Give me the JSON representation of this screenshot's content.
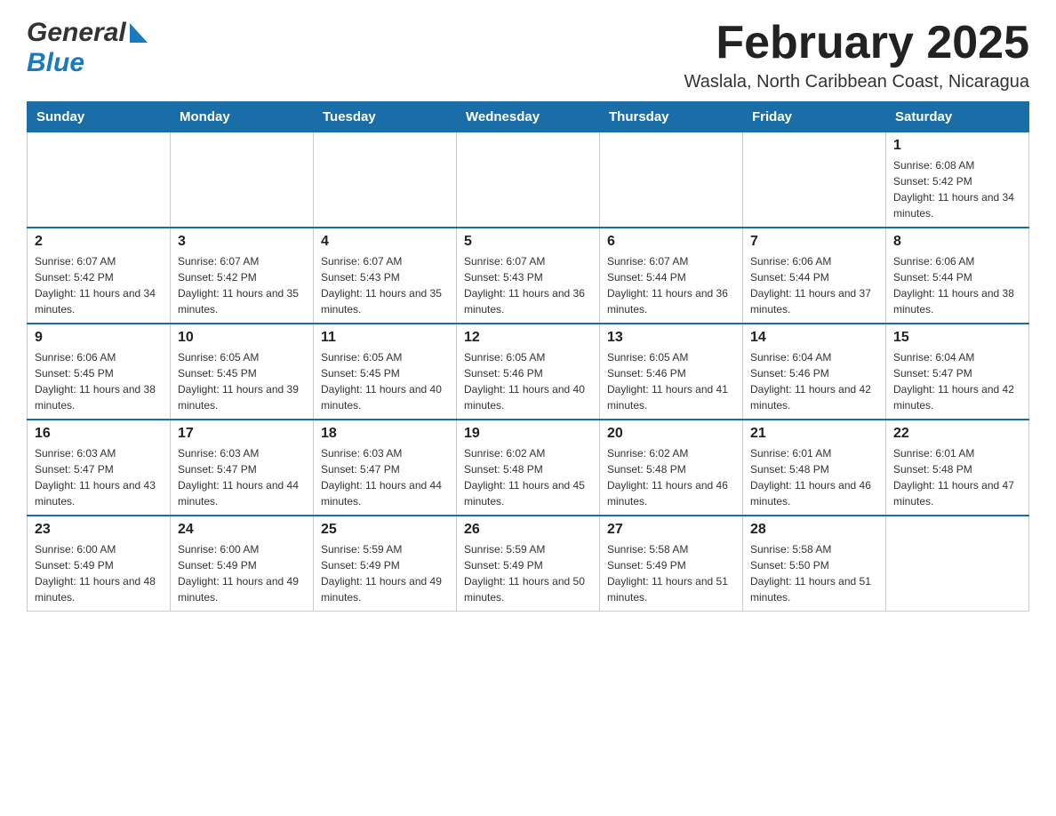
{
  "logo": {
    "line1": "General",
    "arrow_color": "#1a7abf",
    "line2": "Blue"
  },
  "header": {
    "month_year": "February 2025",
    "location": "Waslala, North Caribbean Coast, Nicaragua"
  },
  "days_of_week": [
    "Sunday",
    "Monday",
    "Tuesday",
    "Wednesday",
    "Thursday",
    "Friday",
    "Saturday"
  ],
  "weeks": [
    [
      {
        "day": "",
        "sunrise": "",
        "sunset": "",
        "daylight": "",
        "empty": true
      },
      {
        "day": "",
        "sunrise": "",
        "sunset": "",
        "daylight": "",
        "empty": true
      },
      {
        "day": "",
        "sunrise": "",
        "sunset": "",
        "daylight": "",
        "empty": true
      },
      {
        "day": "",
        "sunrise": "",
        "sunset": "",
        "daylight": "",
        "empty": true
      },
      {
        "day": "",
        "sunrise": "",
        "sunset": "",
        "daylight": "",
        "empty": true
      },
      {
        "day": "",
        "sunrise": "",
        "sunset": "",
        "daylight": "",
        "empty": true
      },
      {
        "day": "1",
        "sunrise": "Sunrise: 6:08 AM",
        "sunset": "Sunset: 5:42 PM",
        "daylight": "Daylight: 11 hours and 34 minutes.",
        "empty": false
      }
    ],
    [
      {
        "day": "2",
        "sunrise": "Sunrise: 6:07 AM",
        "sunset": "Sunset: 5:42 PM",
        "daylight": "Daylight: 11 hours and 34 minutes.",
        "empty": false
      },
      {
        "day": "3",
        "sunrise": "Sunrise: 6:07 AM",
        "sunset": "Sunset: 5:42 PM",
        "daylight": "Daylight: 11 hours and 35 minutes.",
        "empty": false
      },
      {
        "day": "4",
        "sunrise": "Sunrise: 6:07 AM",
        "sunset": "Sunset: 5:43 PM",
        "daylight": "Daylight: 11 hours and 35 minutes.",
        "empty": false
      },
      {
        "day": "5",
        "sunrise": "Sunrise: 6:07 AM",
        "sunset": "Sunset: 5:43 PM",
        "daylight": "Daylight: 11 hours and 36 minutes.",
        "empty": false
      },
      {
        "day": "6",
        "sunrise": "Sunrise: 6:07 AM",
        "sunset": "Sunset: 5:44 PM",
        "daylight": "Daylight: 11 hours and 36 minutes.",
        "empty": false
      },
      {
        "day": "7",
        "sunrise": "Sunrise: 6:06 AM",
        "sunset": "Sunset: 5:44 PM",
        "daylight": "Daylight: 11 hours and 37 minutes.",
        "empty": false
      },
      {
        "day": "8",
        "sunrise": "Sunrise: 6:06 AM",
        "sunset": "Sunset: 5:44 PM",
        "daylight": "Daylight: 11 hours and 38 minutes.",
        "empty": false
      }
    ],
    [
      {
        "day": "9",
        "sunrise": "Sunrise: 6:06 AM",
        "sunset": "Sunset: 5:45 PM",
        "daylight": "Daylight: 11 hours and 38 minutes.",
        "empty": false
      },
      {
        "day": "10",
        "sunrise": "Sunrise: 6:05 AM",
        "sunset": "Sunset: 5:45 PM",
        "daylight": "Daylight: 11 hours and 39 minutes.",
        "empty": false
      },
      {
        "day": "11",
        "sunrise": "Sunrise: 6:05 AM",
        "sunset": "Sunset: 5:45 PM",
        "daylight": "Daylight: 11 hours and 40 minutes.",
        "empty": false
      },
      {
        "day": "12",
        "sunrise": "Sunrise: 6:05 AM",
        "sunset": "Sunset: 5:46 PM",
        "daylight": "Daylight: 11 hours and 40 minutes.",
        "empty": false
      },
      {
        "day": "13",
        "sunrise": "Sunrise: 6:05 AM",
        "sunset": "Sunset: 5:46 PM",
        "daylight": "Daylight: 11 hours and 41 minutes.",
        "empty": false
      },
      {
        "day": "14",
        "sunrise": "Sunrise: 6:04 AM",
        "sunset": "Sunset: 5:46 PM",
        "daylight": "Daylight: 11 hours and 42 minutes.",
        "empty": false
      },
      {
        "day": "15",
        "sunrise": "Sunrise: 6:04 AM",
        "sunset": "Sunset: 5:47 PM",
        "daylight": "Daylight: 11 hours and 42 minutes.",
        "empty": false
      }
    ],
    [
      {
        "day": "16",
        "sunrise": "Sunrise: 6:03 AM",
        "sunset": "Sunset: 5:47 PM",
        "daylight": "Daylight: 11 hours and 43 minutes.",
        "empty": false
      },
      {
        "day": "17",
        "sunrise": "Sunrise: 6:03 AM",
        "sunset": "Sunset: 5:47 PM",
        "daylight": "Daylight: 11 hours and 44 minutes.",
        "empty": false
      },
      {
        "day": "18",
        "sunrise": "Sunrise: 6:03 AM",
        "sunset": "Sunset: 5:47 PM",
        "daylight": "Daylight: 11 hours and 44 minutes.",
        "empty": false
      },
      {
        "day": "19",
        "sunrise": "Sunrise: 6:02 AM",
        "sunset": "Sunset: 5:48 PM",
        "daylight": "Daylight: 11 hours and 45 minutes.",
        "empty": false
      },
      {
        "day": "20",
        "sunrise": "Sunrise: 6:02 AM",
        "sunset": "Sunset: 5:48 PM",
        "daylight": "Daylight: 11 hours and 46 minutes.",
        "empty": false
      },
      {
        "day": "21",
        "sunrise": "Sunrise: 6:01 AM",
        "sunset": "Sunset: 5:48 PM",
        "daylight": "Daylight: 11 hours and 46 minutes.",
        "empty": false
      },
      {
        "day": "22",
        "sunrise": "Sunrise: 6:01 AM",
        "sunset": "Sunset: 5:48 PM",
        "daylight": "Daylight: 11 hours and 47 minutes.",
        "empty": false
      }
    ],
    [
      {
        "day": "23",
        "sunrise": "Sunrise: 6:00 AM",
        "sunset": "Sunset: 5:49 PM",
        "daylight": "Daylight: 11 hours and 48 minutes.",
        "empty": false
      },
      {
        "day": "24",
        "sunrise": "Sunrise: 6:00 AM",
        "sunset": "Sunset: 5:49 PM",
        "daylight": "Daylight: 11 hours and 49 minutes.",
        "empty": false
      },
      {
        "day": "25",
        "sunrise": "Sunrise: 5:59 AM",
        "sunset": "Sunset: 5:49 PM",
        "daylight": "Daylight: 11 hours and 49 minutes.",
        "empty": false
      },
      {
        "day": "26",
        "sunrise": "Sunrise: 5:59 AM",
        "sunset": "Sunset: 5:49 PM",
        "daylight": "Daylight: 11 hours and 50 minutes.",
        "empty": false
      },
      {
        "day": "27",
        "sunrise": "Sunrise: 5:58 AM",
        "sunset": "Sunset: 5:49 PM",
        "daylight": "Daylight: 11 hours and 51 minutes.",
        "empty": false
      },
      {
        "day": "28",
        "sunrise": "Sunrise: 5:58 AM",
        "sunset": "Sunset: 5:50 PM",
        "daylight": "Daylight: 11 hours and 51 minutes.",
        "empty": false
      },
      {
        "day": "",
        "sunrise": "",
        "sunset": "",
        "daylight": "",
        "empty": true
      }
    ]
  ]
}
